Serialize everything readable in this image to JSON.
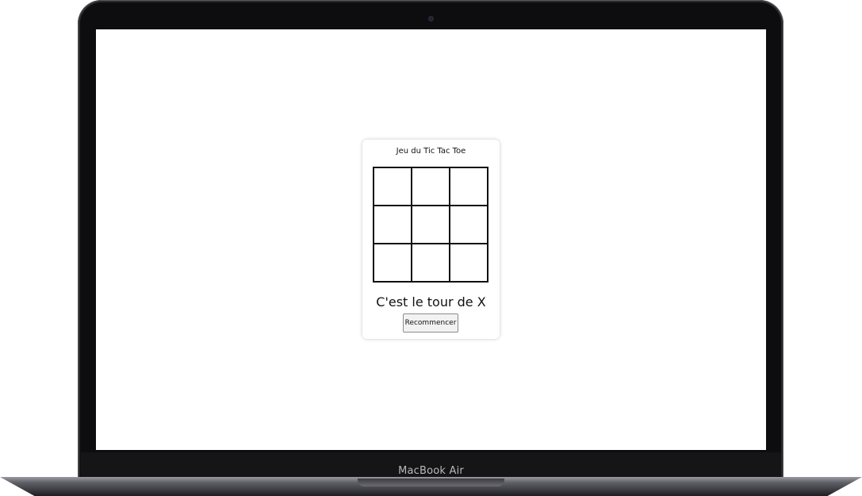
{
  "device": {
    "label": "MacBook Air"
  },
  "game": {
    "title": "Jeu du Tic Tac Toe",
    "board": [
      "",
      "",
      "",
      "",
      "",
      "",
      "",
      "",
      ""
    ],
    "status": "C'est le tour de X",
    "restart_label": "Recommencer"
  }
}
